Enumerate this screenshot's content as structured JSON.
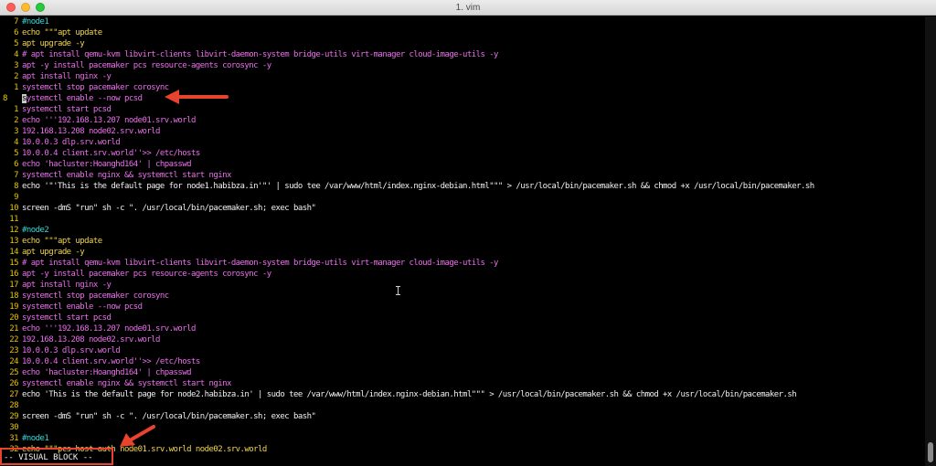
{
  "window": {
    "title": "1. vim"
  },
  "lines": [
    {
      "num": "7",
      "text": "#node1",
      "color": "c"
    },
    {
      "num": "6",
      "text": "echo \"\"\"apt update",
      "color": "y"
    },
    {
      "num": "5",
      "text": "apt upgrade -y",
      "color": "y"
    },
    {
      "num": "4",
      "text": "# apt install qemu-kvm libvirt-clients libvirt-daemon-system bridge-utils virt-manager cloud-image-utils -y",
      "color": "p"
    },
    {
      "num": "3",
      "text": "apt -y install pacemaker pcs resource-agents corosync -y",
      "color": "p"
    },
    {
      "num": "2",
      "text": "apt install nginx -y",
      "color": "p"
    },
    {
      "num": "1",
      "text": "systemctl stop pacemaker corosync",
      "color": "p"
    },
    {
      "num": "8",
      "text": "systemctl enable --now pcsd",
      "color": "p",
      "current": true
    },
    {
      "num": "1",
      "text": "systemctl start pcsd",
      "color": "p"
    },
    {
      "num": "2",
      "text": "echo '''192.168.13.207 node01.srv.world",
      "color": "p"
    },
    {
      "num": "3",
      "text": "192.168.13.208 node02.srv.world",
      "color": "p"
    },
    {
      "num": "4",
      "text": "10.0.0.3 dlp.srv.world",
      "color": "p"
    },
    {
      "num": "5",
      "text": "10.0.0.4 client.srv.world''>> /etc/hosts",
      "color": "p"
    },
    {
      "num": "6",
      "text": "echo 'hacluster:Hoanghd164' | chpasswd",
      "color": "p"
    },
    {
      "num": "7",
      "text": "systemctl enable nginx && systemctl start nginx",
      "color": "p"
    },
    {
      "num": "8",
      "text": "echo '\"'This is the default page for node1.habibza.in'\"' | sudo tee /var/www/html/index.nginx-debian.html\"\"\" > /usr/local/bin/pacemaker.sh && chmod +x /usr/local/bin/pacemaker.sh",
      "color": "w"
    },
    {
      "num": "9",
      "text": "",
      "color": "w"
    },
    {
      "num": "10",
      "text": "screen -dmS \"run\" sh -c \". /usr/local/bin/pacemaker.sh; exec bash\"",
      "color": "w"
    },
    {
      "num": "11",
      "text": "",
      "color": "w"
    },
    {
      "num": "12",
      "text": "#node2",
      "color": "c"
    },
    {
      "num": "13",
      "text": "echo \"\"\"apt update",
      "color": "y"
    },
    {
      "num": "14",
      "text": "apt upgrade -y",
      "color": "y"
    },
    {
      "num": "15",
      "text": "# apt install qemu-kvm libvirt-clients libvirt-daemon-system bridge-utils virt-manager cloud-image-utils -y",
      "color": "p"
    },
    {
      "num": "16",
      "text": "apt -y install pacemaker pcs resource-agents corosync -y",
      "color": "p"
    },
    {
      "num": "17",
      "text": "apt install nginx -y",
      "color": "p"
    },
    {
      "num": "18",
      "text": "systemctl stop pacemaker corosync",
      "color": "p"
    },
    {
      "num": "19",
      "text": "systemctl enable --now pcsd",
      "color": "p"
    },
    {
      "num": "20",
      "text": "systemctl start pcsd",
      "color": "p"
    },
    {
      "num": "21",
      "text": "echo '''192.168.13.207 node01.srv.world",
      "color": "p"
    },
    {
      "num": "22",
      "text": "192.168.13.208 node02.srv.world",
      "color": "p"
    },
    {
      "num": "23",
      "text": "10.0.0.3 dlp.srv.world",
      "color": "p"
    },
    {
      "num": "24",
      "text": "10.0.0.4 client.srv.world''>> /etc/hosts",
      "color": "p"
    },
    {
      "num": "25",
      "text": "echo 'hacluster:Hoanghd164' | chpasswd",
      "color": "p"
    },
    {
      "num": "26",
      "text": "systemctl enable nginx && systemctl start nginx",
      "color": "p"
    },
    {
      "num": "27",
      "text": "echo 'This is the default page for node2.habibza.in' | sudo tee /var/www/html/index.nginx-debian.html\"\"\" > /usr/local/bin/pacemaker.sh && chmod +x /usr/local/bin/pacemaker.sh",
      "color": "w"
    },
    {
      "num": "28",
      "text": "",
      "color": "w"
    },
    {
      "num": "29",
      "text": "screen -dmS \"run\" sh -c \". /usr/local/bin/pacemaker.sh; exec bash\"",
      "color": "w"
    },
    {
      "num": "30",
      "text": "",
      "color": "w"
    },
    {
      "num": "31",
      "text": "#node1",
      "color": "c"
    },
    {
      "num": "32",
      "text": "echo \"\"\"pcs host auth node01.srv.world node02.srv.world",
      "color": "y"
    }
  ],
  "status": {
    "mode": "-- VISUAL BLOCK --"
  },
  "colors": {
    "line_number": "#e5c500",
    "comment_cyan": "#35d8d8",
    "string_yellow": "#f3d64a",
    "string_magenta": "#ec6fec",
    "annotation_red": "#e8432f"
  },
  "annotations": [
    "red-arrow-icon",
    "red-arrow-icon",
    "red-highlight-box"
  ]
}
